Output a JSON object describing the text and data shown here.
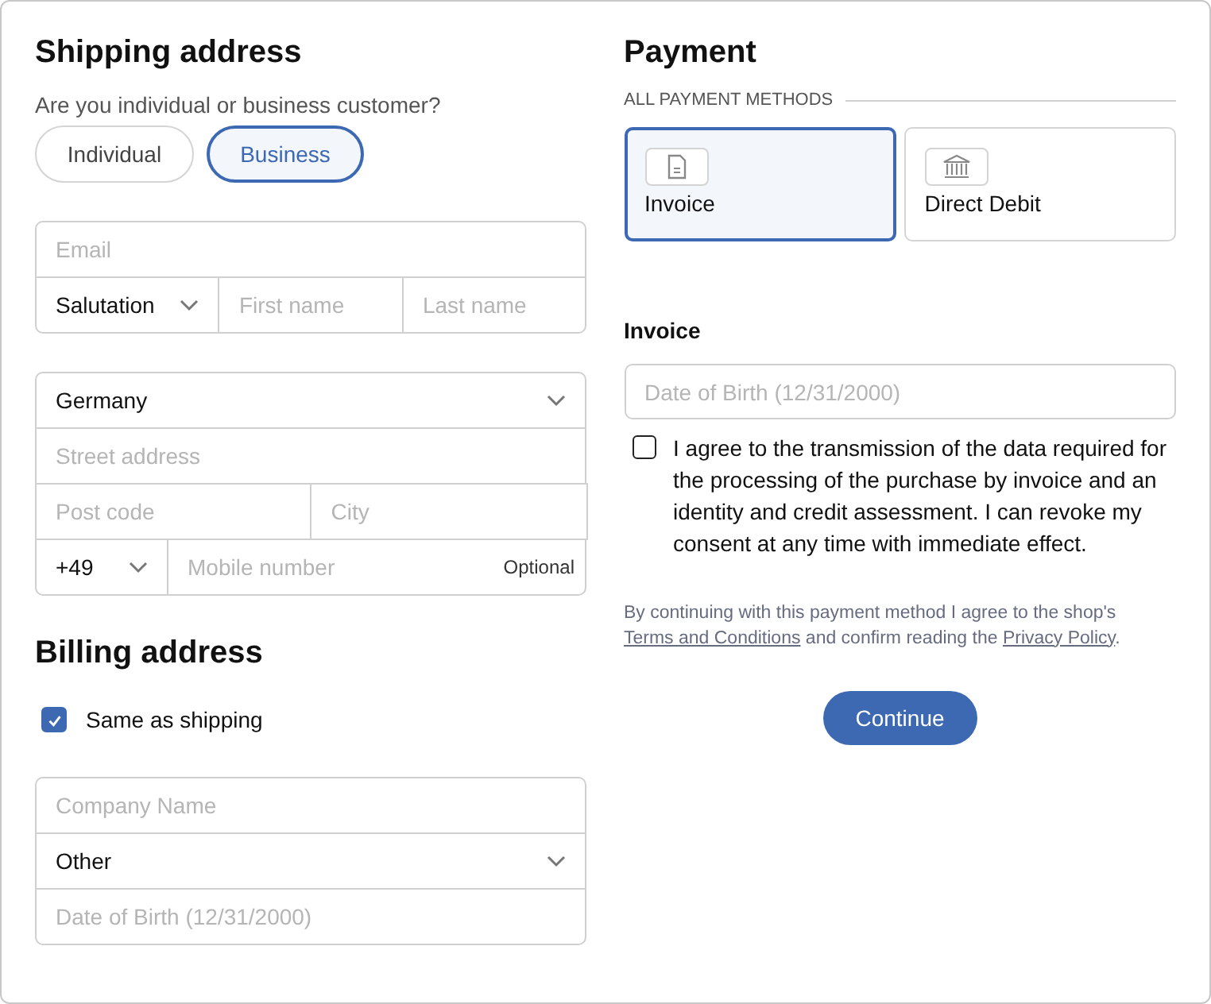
{
  "shipping": {
    "title": "Shipping address",
    "question": "Are you individual or business customer?",
    "customer_types": [
      {
        "label": "Individual",
        "selected": false
      },
      {
        "label": "Business",
        "selected": true
      }
    ],
    "email": {
      "placeholder": "Email"
    },
    "salutation": {
      "value": "Salutation"
    },
    "first_name": {
      "placeholder": "First name"
    },
    "last_name": {
      "placeholder": "Last name"
    },
    "country": {
      "value": "Germany"
    },
    "street": {
      "placeholder": "Street address"
    },
    "post_code": {
      "placeholder": "Post code"
    },
    "city": {
      "placeholder": "City"
    },
    "dial_code": {
      "value": "+49"
    },
    "mobile": {
      "placeholder": "Mobile number",
      "hint": "Optional"
    }
  },
  "billing": {
    "title": "Billing address",
    "same_as_shipping": {
      "label": "Same as shipping",
      "checked": true
    },
    "company": {
      "placeholder": "Company Name"
    },
    "salutation": {
      "value": "Other"
    },
    "date_of_birth": {
      "placeholder": "Date of Birth (12/31/2000)"
    }
  },
  "payment": {
    "title": "Payment",
    "methods_heading": "ALL PAYMENT METHODS",
    "methods": [
      {
        "kind": "invoice",
        "label": "Invoice",
        "selected": true
      },
      {
        "kind": "bank",
        "label": "Direct Debit",
        "selected": false
      }
    ],
    "section_title": "Invoice",
    "date_of_birth": {
      "placeholder": "Date of Birth (12/31/2000)"
    },
    "consent": {
      "text": "I agree to the transmission of the data required for the processing of the purchase by invoice and an identity and credit assessment. I can revoke my consent at any time with immediate effect.",
      "checked": false
    },
    "legal": [
      {
        "kind": "text",
        "text": "By continuing with this payment method I agree to the shop's "
      },
      {
        "kind": "link",
        "text": "Terms and Conditions"
      },
      {
        "kind": "text",
        "text": " and confirm reading the "
      },
      {
        "kind": "link",
        "text": "Privacy Policy"
      },
      {
        "kind": "text",
        "text": "."
      }
    ],
    "continue_button": "Continue"
  }
}
